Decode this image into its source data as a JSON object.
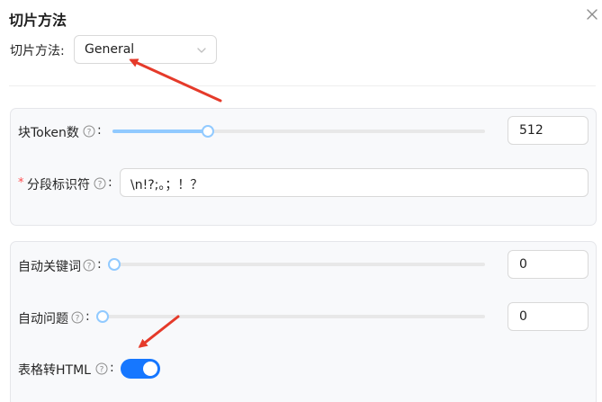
{
  "dialog": {
    "title": "切片方法",
    "close_icon": "close-icon"
  },
  "method": {
    "label": "切片方法:",
    "value": "General",
    "icon": "chevron-down-icon"
  },
  "general_card": {
    "chunk_token": {
      "label": "块Token数",
      "help_icon": "question-circle-icon",
      "value": "512",
      "slider_fraction": 0.25
    },
    "delimiter": {
      "required_mark": "*",
      "label": "分段标识符",
      "help_icon": "question-circle-icon",
      "value": "\\n!?;。；！？"
    }
  },
  "advanced_card": {
    "auto_keywords": {
      "label": "自动关键词",
      "help_icon": "question-circle-icon",
      "value": "0",
      "slider_fraction": 0
    },
    "auto_questions": {
      "label": "自动问题",
      "help_icon": "question-circle-icon",
      "value": "0",
      "slider_fraction": 0
    },
    "table_to_html": {
      "label": "表格转HTML",
      "help_icon": "question-circle-icon",
      "enabled": true
    }
  },
  "colors": {
    "primary": "#1677ff",
    "slider_light": "#91caff",
    "required": "#ff4d4f",
    "annotation_arrow": "#e53a2a"
  }
}
